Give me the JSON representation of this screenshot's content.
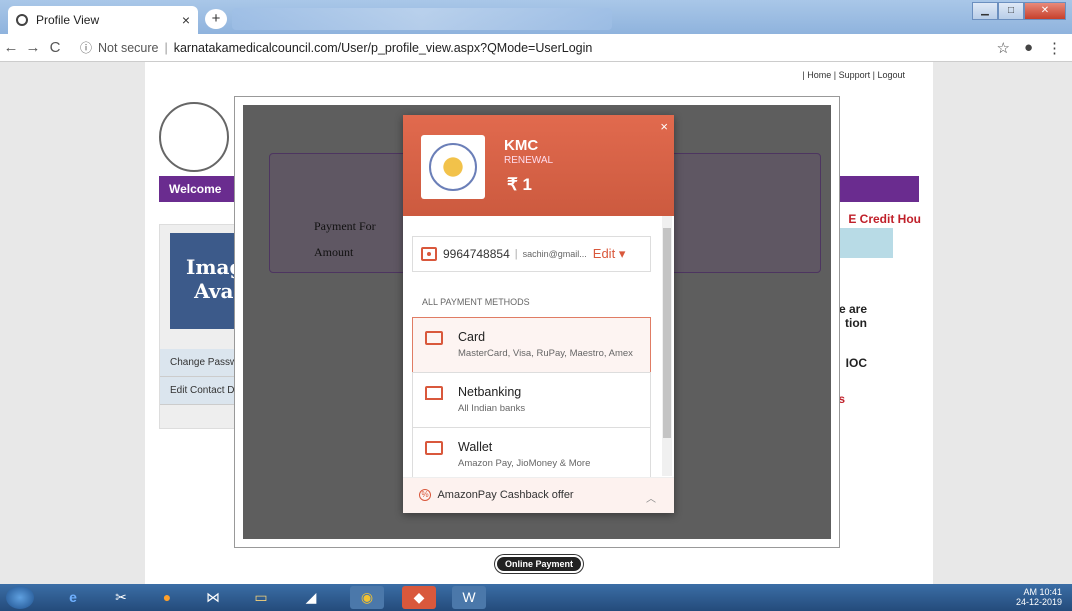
{
  "browser": {
    "tab_title": "Profile View",
    "tab_close": "×",
    "new_tab": "+",
    "security_label": "Not secure",
    "separator": "|",
    "url": "karnatakamedicalcouncil.com/User/p_profile_view.aspx?QMode=UserLogin"
  },
  "page": {
    "toplinks": "| Home | Support | Logout",
    "welcome": "Welcome",
    "credit_hours": "E Credit Hou",
    "image_na": "Image Not Available",
    "side_links": [
      "Change Passw",
      "Edit Contact D"
    ],
    "right_text_1": "e are",
    "right_text_2": "tion",
    "right_text_3": "IOC",
    "right_link": "s",
    "payment_for_label": "Payment For",
    "amount_label": "Amount",
    "online_payment_button": "Online Payment"
  },
  "modal": {
    "merchant": "KMC",
    "subtitle": "RENEWAL",
    "amount": "₹ 1",
    "close": "×",
    "phone": "9964748854",
    "email": "sachin@gmail...",
    "edit_label": "Edit",
    "section_label": "ALL PAYMENT METHODS",
    "methods": [
      {
        "name": "Card",
        "desc": "MasterCard, Visa, RuPay, Maestro, Amex",
        "icon": "card-icon"
      },
      {
        "name": "Netbanking",
        "desc": "All Indian banks",
        "icon": "bank-icon"
      },
      {
        "name": "Wallet",
        "desc": "Amazon Pay, JioMoney & More",
        "icon": "wallet-icon"
      }
    ],
    "offer": "AmazonPay Cashback offer",
    "accent": "#d9583c"
  },
  "taskbar": {
    "time": "AM 10:41",
    "date": "24-12-2019"
  }
}
